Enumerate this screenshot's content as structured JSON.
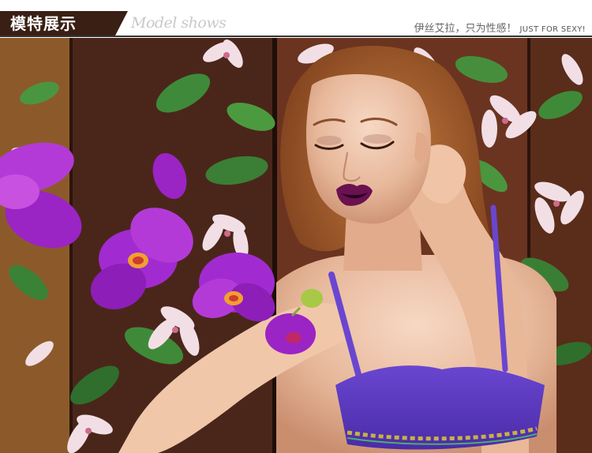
{
  "header": {
    "title": "模特展示",
    "subtitle": "Model shows",
    "slogan_cn": "伊丝艾拉，只为性感！",
    "slogan_en": "JUST FOR SEXY!"
  },
  "photo": {
    "subject": "model-photo",
    "colors": {
      "accent_dark": "#3a1f14",
      "orchid": "#a12bd0",
      "bra": "#5e3cc0",
      "lips": "#6a1150",
      "hair": "#a55a2a"
    }
  }
}
